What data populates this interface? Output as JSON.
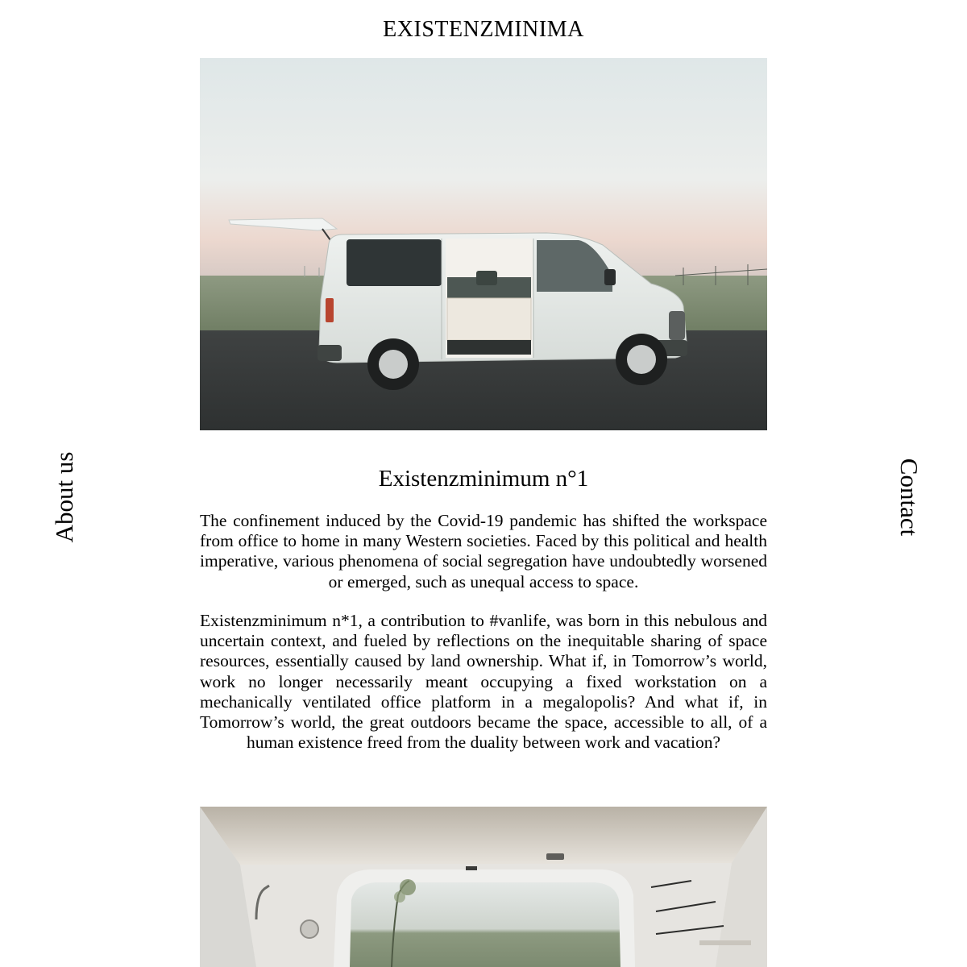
{
  "site": {
    "title": "EXISTENZMINIMA"
  },
  "nav": {
    "about_label": "About us",
    "contact_label": "Contact"
  },
  "project": {
    "title": "Existenzminimum n°1",
    "paragraphs": [
      "The confinement induced by the Covid-19 pandemic has shifted the workspace from office to home in many Western societies. Faced by this political and health imperative, various phenomena of social segregation have undoubtedly worsened or emerged, such as unequal access to space.",
      "Existenzminimum n*1, a contribution to #vanlife, was born in this nebulous and uncertain context, and fueled by reflections on the inequitable sharing of space resources, essentially caused by land ownership. What if, in Tomorrow’s world, work no longer necessarily meant occupying a fixed workstation on a mechanically ventilated office platform in a megalopolis? And what if, in Tomorrow’s world, the great outdoors became the space, accessible to all, of a human existence freed from the duality between work and vacation?"
    ]
  },
  "images": [
    {
      "id": "van-exterior-photo",
      "subject": "white camper van parked on road with side and rear doors open"
    },
    {
      "id": "van-interior-photo",
      "subject": "view from inside the van toward the open rear door"
    }
  ],
  "colors": {
    "background": "#ffffff",
    "text": "#000000",
    "van_body": "#e9ecea"
  }
}
